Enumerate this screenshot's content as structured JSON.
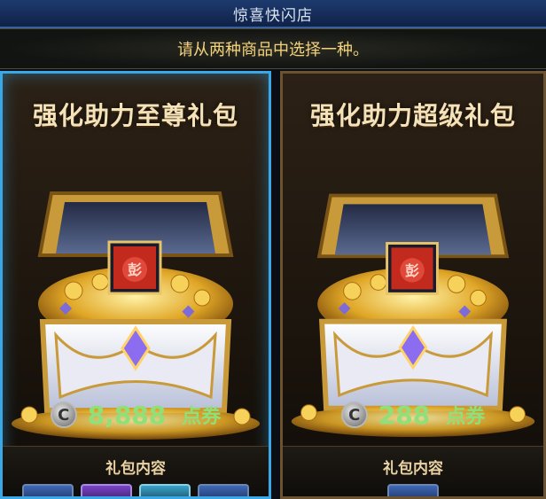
{
  "window": {
    "title": "惊喜快闪店"
  },
  "instruction": "请从两种商品中选择一种。",
  "packages": [
    {
      "title": "强化助力至尊礼包",
      "price": "8,888",
      "currency_unit": "点券",
      "currency_icon": "cera-coin-icon",
      "contents_label": "礼包内容",
      "item_icon": "gift-pouch-item-icon",
      "selected": true,
      "border_color": "#3aa8e6"
    },
    {
      "title": "强化助力超级礼包",
      "price": "288",
      "currency_unit": "点券",
      "currency_icon": "cera-coin-icon",
      "contents_label": "礼包内容",
      "item_icon": "gift-pouch-item-icon",
      "selected": false,
      "border_color": "#6b5230"
    }
  ],
  "colors": {
    "price_green": "#8fe07a",
    "title_cream": "#f4e2b8",
    "instruction_gold": "#f2d27a"
  }
}
